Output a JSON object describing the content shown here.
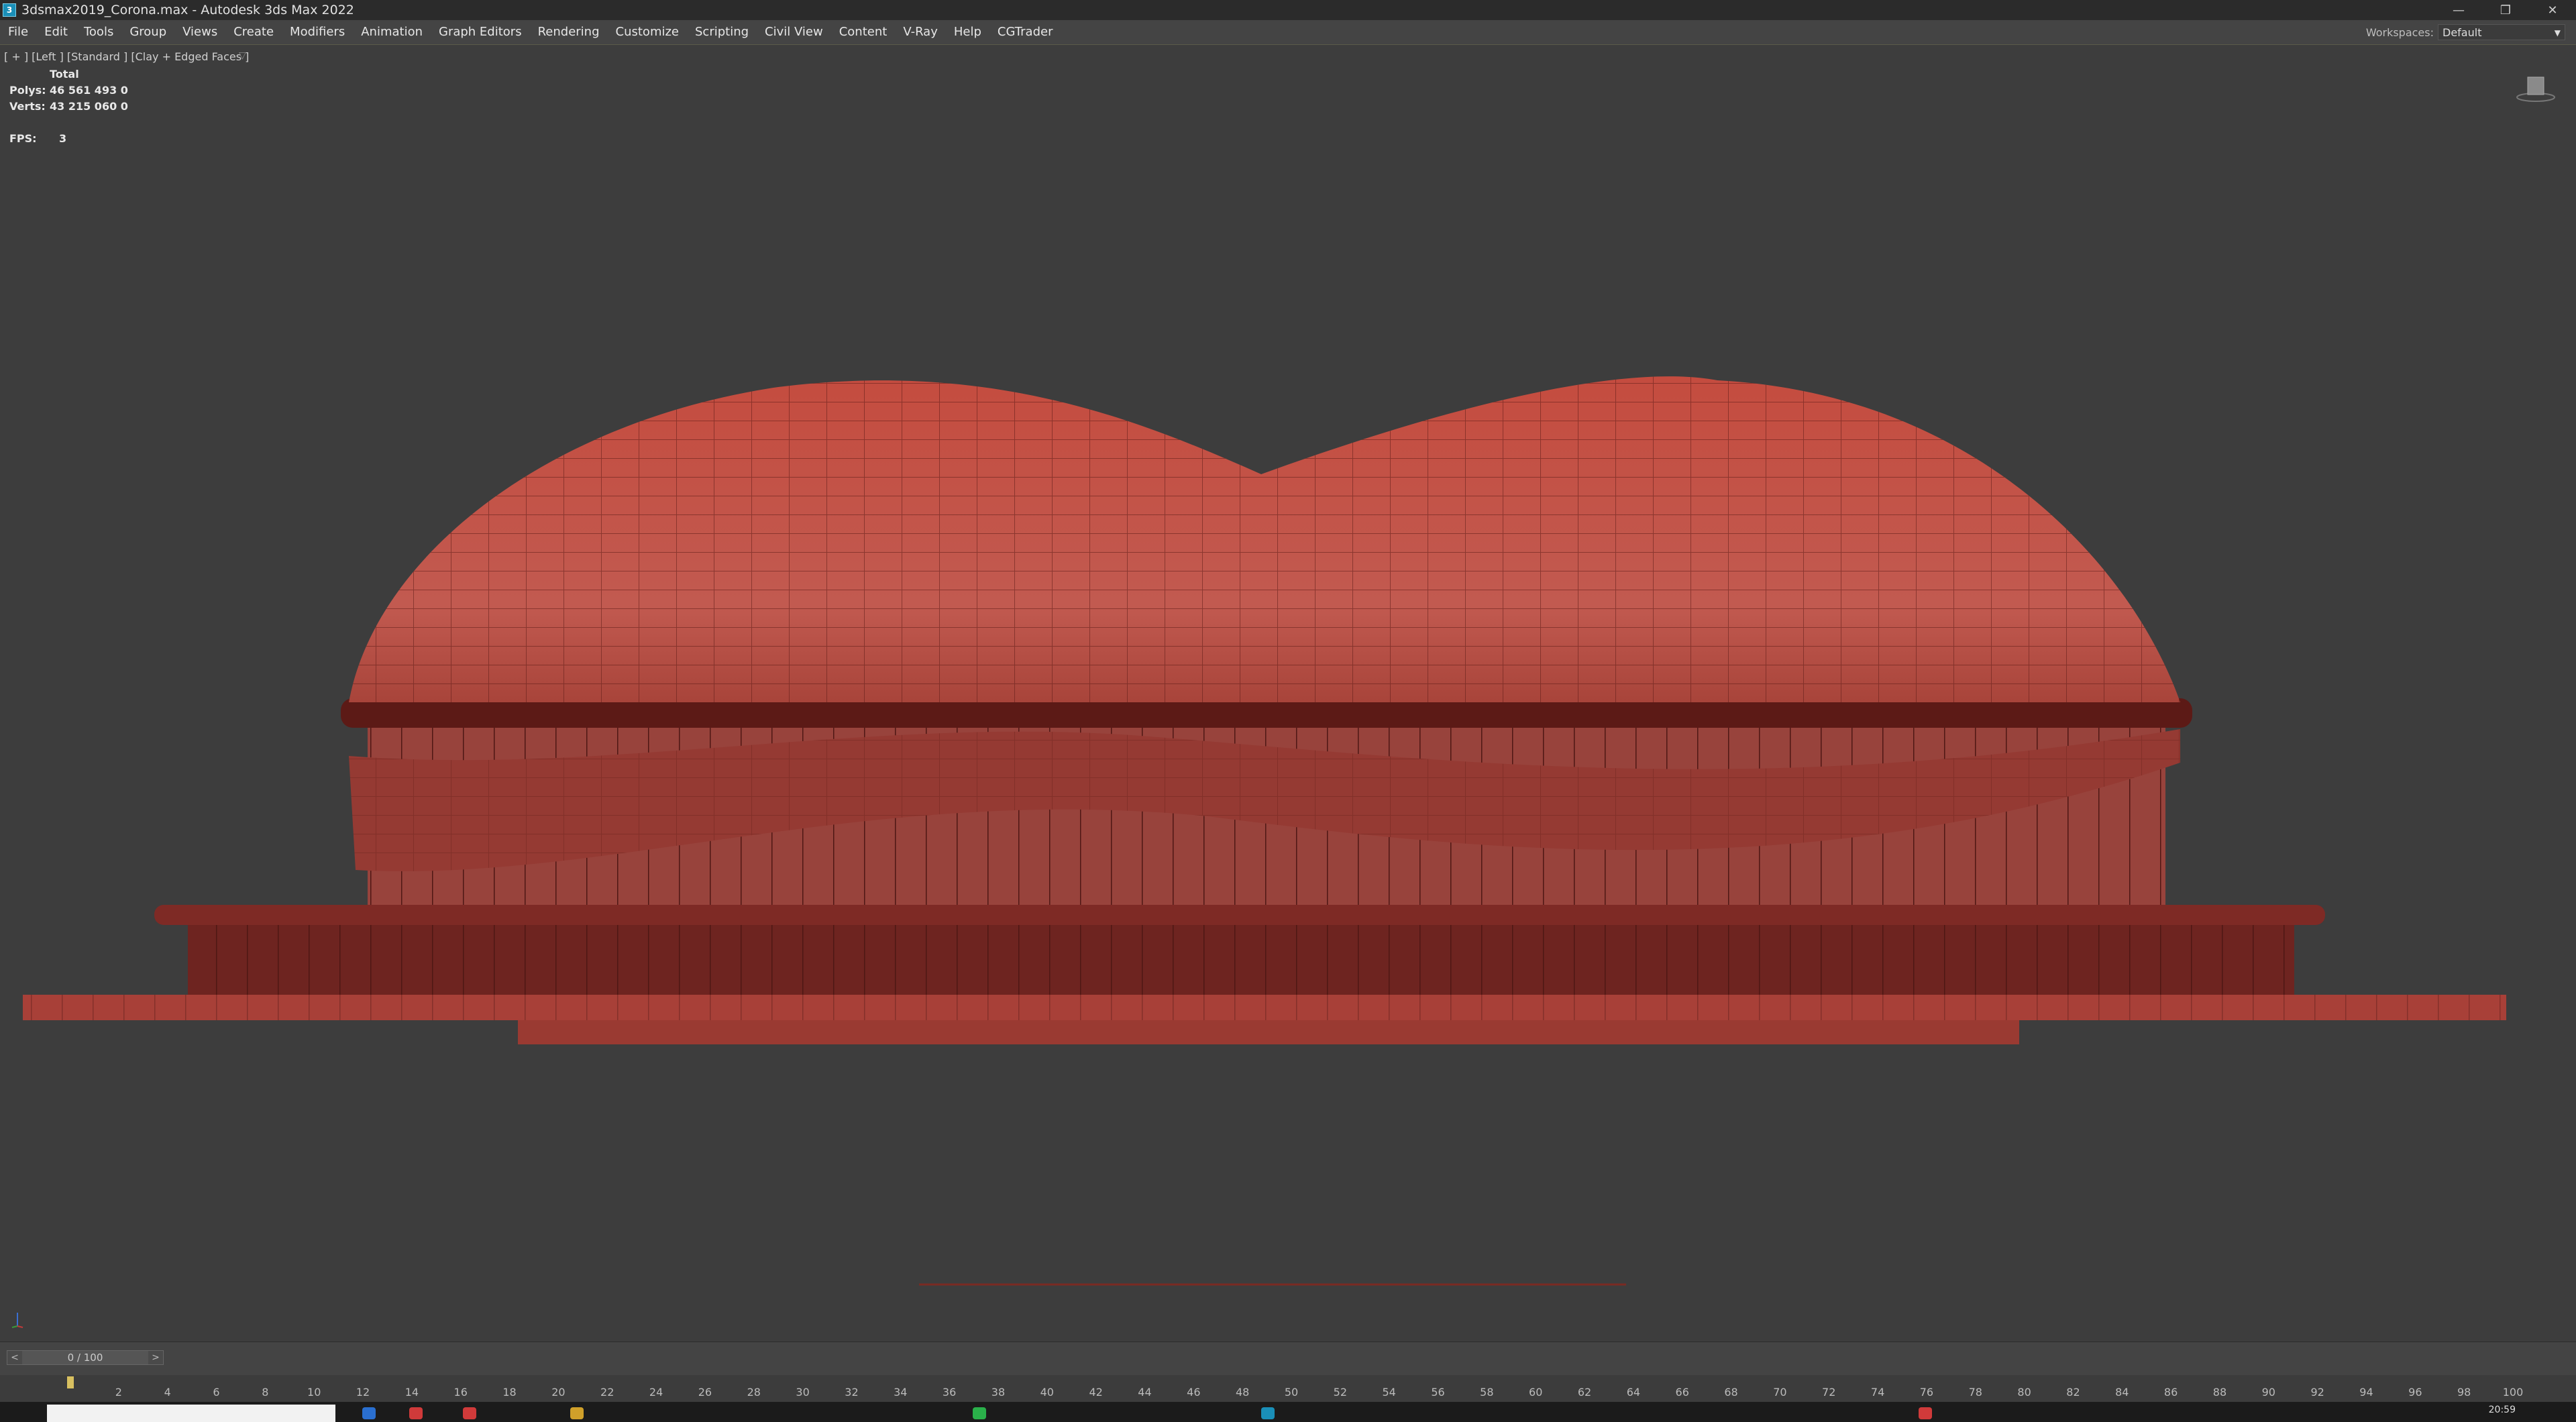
{
  "window": {
    "title": "3dsmax2019_Corona.max - Autodesk 3ds Max 2022",
    "app_icon": "3",
    "controls": [
      "—",
      "❐",
      "✕"
    ]
  },
  "menu": {
    "items": [
      "File",
      "Edit",
      "Tools",
      "Group",
      "Views",
      "Create",
      "Modifiers",
      "Animation",
      "Graph Editors",
      "Rendering",
      "Customize",
      "Scripting",
      "Civil View",
      "Content",
      "V-Ray",
      "Help",
      "CGTrader"
    ],
    "workspace_label": "Workspaces:",
    "workspace_value": "Default"
  },
  "viewport": {
    "label": "[ + ] [Left ] [Standard ] [Clay + Edged Faces ]",
    "stats": {
      "header": "Total",
      "polys_label": "Polys:",
      "polys_value": "46 561 493 0",
      "verts_label": "Verts:",
      "verts_value": "43 215 060 0",
      "fps_label": "FPS:",
      "fps_value": "3"
    },
    "model_color": "#b84a40",
    "background": "#3d3d3d"
  },
  "timeline": {
    "slider_value": "0 / 100",
    "prev_icon": "<",
    "next_icon": ">",
    "ticks": [
      2,
      4,
      6,
      8,
      10,
      12,
      14,
      16,
      18,
      20,
      22,
      24,
      26,
      28,
      30,
      32,
      34,
      36,
      38,
      40,
      42,
      44,
      46,
      48,
      50,
      52,
      54,
      56,
      58,
      60,
      62,
      64,
      66,
      68,
      70,
      72,
      74,
      76,
      78,
      80,
      82,
      84,
      86,
      88,
      90,
      92,
      94,
      96,
      98,
      100
    ]
  },
  "taskbar": {
    "clock": "20:59"
  }
}
